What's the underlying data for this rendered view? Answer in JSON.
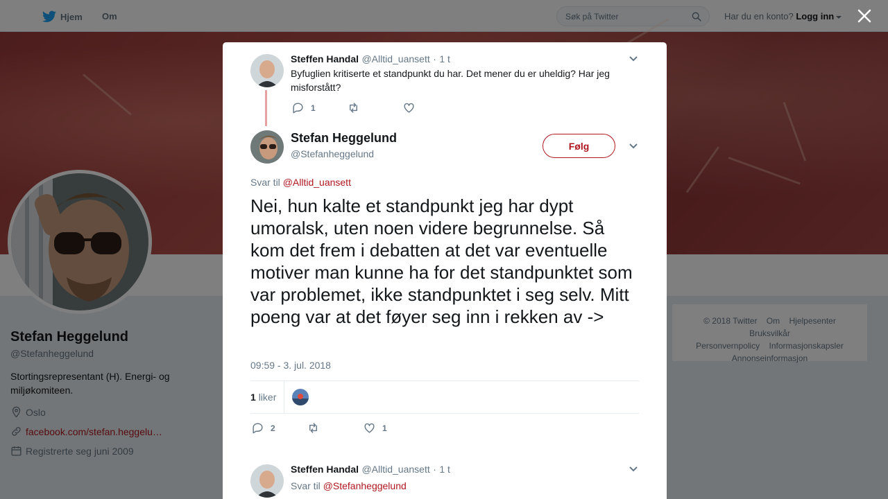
{
  "nav": {
    "home_label": "Hjem",
    "about_label": "Om",
    "search_placeholder": "Søk på Twitter",
    "account_prompt": "Har du en konto?",
    "login_label": "Logg inn"
  },
  "profile": {
    "name": "Stefan Heggelund",
    "handle": "@Stefanheggelund",
    "bio": "Stortingsrepresentant (H). Energi- og miljøkomiteen.",
    "location": "Oslo",
    "website": "facebook.com/stefan.heggelu…",
    "joined": "Registrerte seg juni 2009"
  },
  "footer": {
    "links": [
      "© 2018 Twitter",
      "Om",
      "Hjelpesenter",
      "Bruksvilkår",
      "Personvernpolicy",
      "Informasjonskapsler",
      "Annonseinformasjon"
    ]
  },
  "parent_tweet": {
    "name": "Steffen Handal",
    "handle": "@Alltid_uansett",
    "sep": "·",
    "time": "1 t",
    "text": "Byfuglien kritiserte et standpunkt du har. Det mener du er uheldig? Har jeg misforstått?",
    "reply_count": "1",
    "retweet_count": "",
    "like_count": ""
  },
  "main_tweet": {
    "name": "Stefan Heggelund",
    "handle": "@Stefanheggelund",
    "follow_label": "Følg",
    "reply_to_label": "Svar til",
    "reply_to_mention": "@Alltid_uansett",
    "text": "Nei, hun kalte et standpunkt jeg har dypt umoralsk, uten noen videre begrunnelse. Så kom det frem i debatten at det var eventuelle motiver man kunne ha for det standpunktet som var problemet, ikke standpunktet i seg selv. Mitt poeng var at det føyer seg inn i rekken av ->",
    "timestamp": "09:59 - 3. jul. 2018",
    "likes_count": "1",
    "likes_label": "liker",
    "reply_count": "2",
    "retweet_count": "",
    "like_count": "1"
  },
  "reply_tweet": {
    "name": "Steffen Handal",
    "handle": "@Alltid_uansett",
    "sep": "·",
    "time": "1 t",
    "reply_to_label": "Svar til",
    "reply_to_mention": "@Stefanheggelund"
  },
  "colors": {
    "accent": "#b0171f",
    "twitter_blue": "#1da1f2",
    "muted": "#657786"
  }
}
